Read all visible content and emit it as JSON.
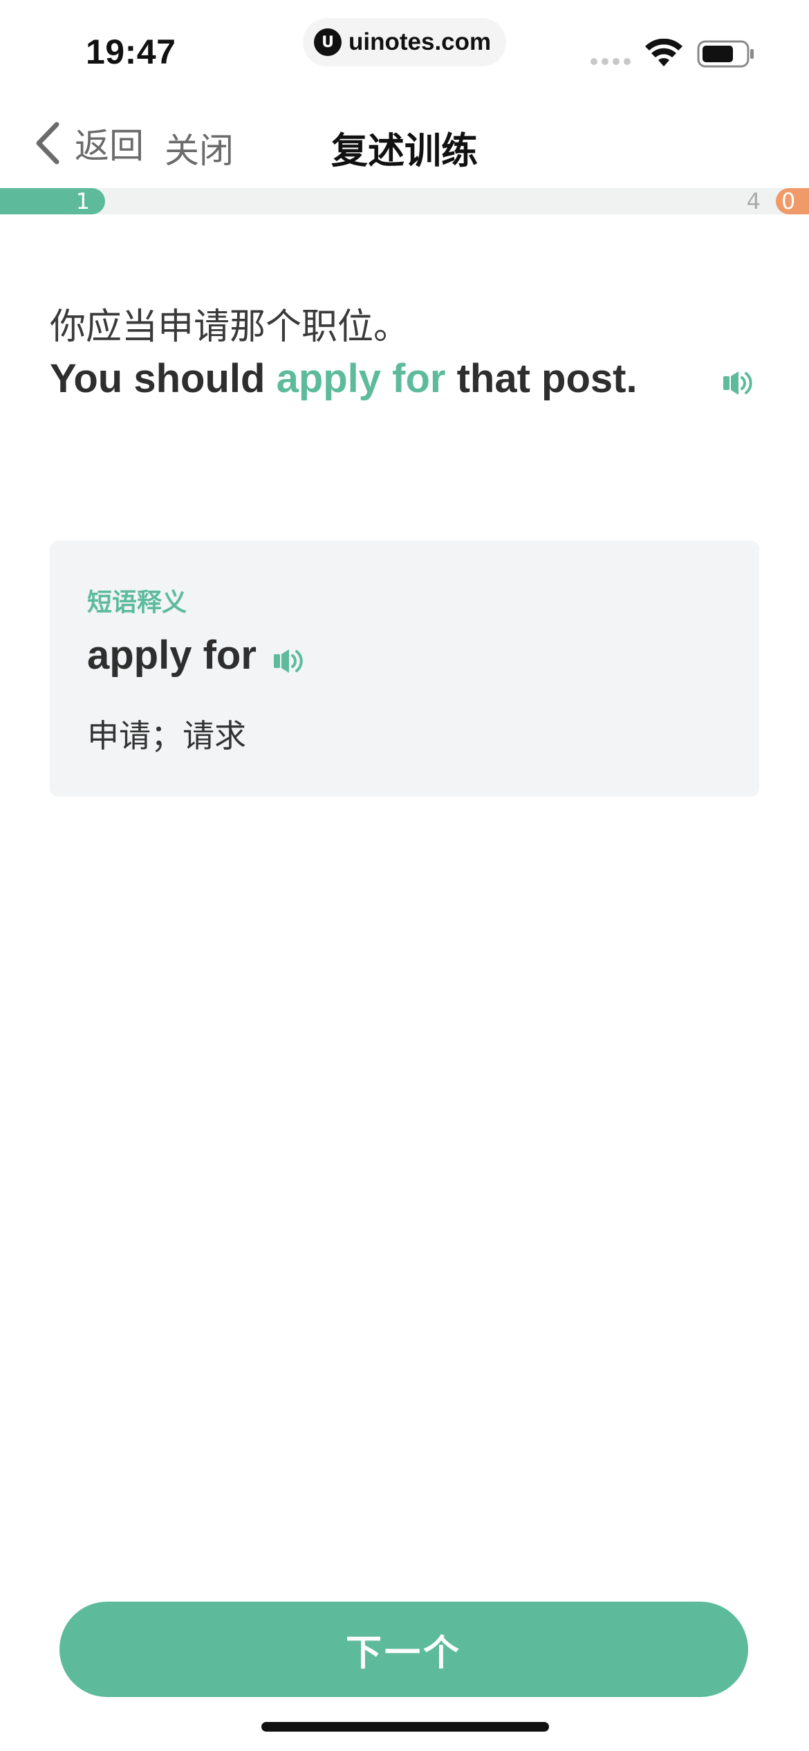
{
  "status_bar": {
    "time": "19:47",
    "url": "uinotes.com",
    "url_logo_glyph": "U",
    "icons": [
      "signal-icon",
      "wifi-icon",
      "battery-icon"
    ]
  },
  "nav": {
    "back_label": "返回",
    "close_label": "关闭",
    "title": "复述训练"
  },
  "progress": {
    "current": "1",
    "total": "4",
    "wrong": "0",
    "fraction": 0.13,
    "colors": {
      "fill": "#5dbb9c",
      "track": "#f0f2f2",
      "wrong": "#f19a69"
    }
  },
  "sentence": {
    "chinese": "你应当申请那个职位。",
    "english_before": "You should ",
    "english_highlight": "apply for",
    "english_after": " that post."
  },
  "phrase_card": {
    "heading": "短语释义",
    "term": "apply for",
    "meaning": "申请；请求"
  },
  "next_button": {
    "label": "下一个"
  },
  "colors": {
    "accent": "#5dbb9c",
    "text": "#2e2e2e"
  }
}
